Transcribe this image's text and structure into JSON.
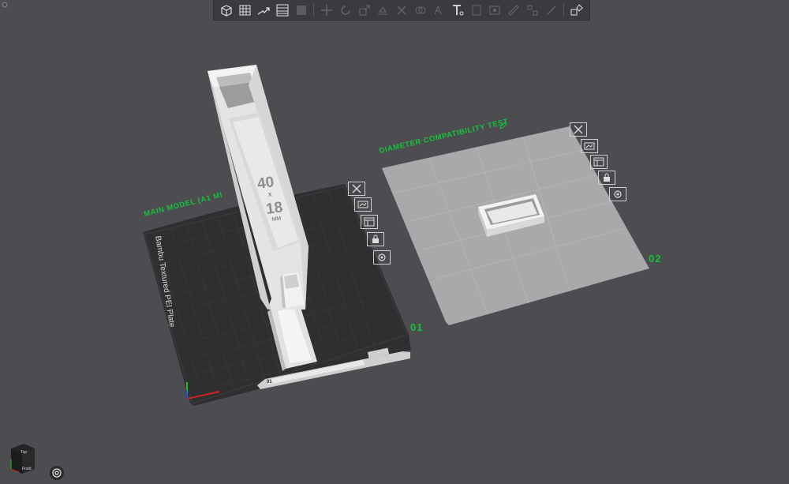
{
  "toolbar": {
    "buttons": [
      {
        "name": "add-object",
        "icon": "cube-add-icon"
      },
      {
        "name": "add-plate",
        "icon": "grid-plate-icon"
      },
      {
        "name": "auto-arrange",
        "icon": "arrange-icon"
      },
      {
        "name": "orient",
        "icon": "plate-layout-icon"
      },
      {
        "name": "split",
        "icon": "split-icon"
      },
      {
        "name": "move",
        "icon": "move-icon"
      },
      {
        "name": "rotate",
        "icon": "rotate-icon"
      },
      {
        "name": "scale",
        "icon": "scale-icon"
      },
      {
        "name": "lay-on-face",
        "icon": "lay-face-icon"
      },
      {
        "name": "cut",
        "icon": "cut-icon"
      },
      {
        "name": "mesh-boolean",
        "icon": "boolean-icon"
      },
      {
        "name": "support-paint",
        "icon": "support-paint-icon"
      },
      {
        "name": "text",
        "icon": "text-icon"
      },
      {
        "name": "seam-paint",
        "icon": "seam-icon"
      },
      {
        "name": "color-paint",
        "icon": "color-paint-icon"
      },
      {
        "name": "measure",
        "icon": "measure-icon"
      },
      {
        "name": "assembly",
        "icon": "assembly-icon"
      },
      {
        "name": "variable-layer",
        "icon": "layer-icon"
      },
      {
        "name": "explode",
        "icon": "explode-icon"
      }
    ]
  },
  "plates": [
    {
      "label": "MAIN MODEL (A1 MI",
      "number": "01",
      "bed_name": "Bambu Textured PEI Plate",
      "tag": "01"
    },
    {
      "label": "DIAMETER COMPATIBILITY TEST",
      "number": "02"
    }
  ],
  "model": {
    "emboss_line1": "40",
    "emboss_x": "x",
    "emboss_line2": "18",
    "emboss_unit": "MM"
  },
  "view_cube": {
    "top": "Top",
    "front": "Front"
  },
  "colors": {
    "accent": "#12c23b",
    "background": "#4d4c51",
    "toolbar": "#3b3a3f",
    "bed_dark": "#2f2f31",
    "bed_light": "#a9a9ac",
    "model": "#e6e6e6"
  }
}
